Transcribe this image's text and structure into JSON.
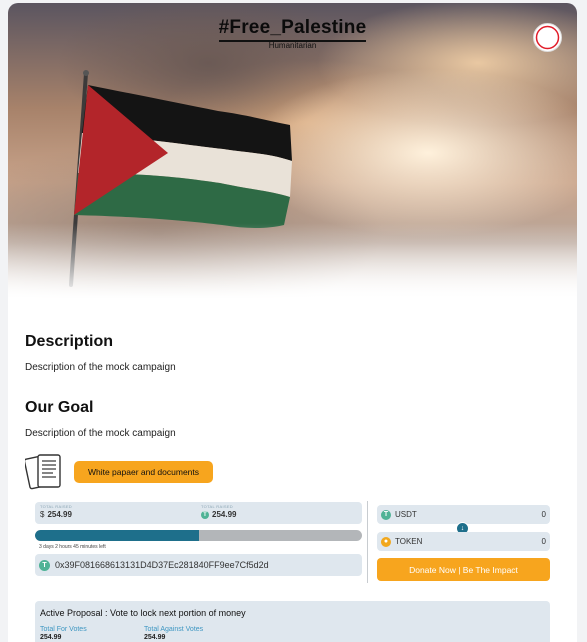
{
  "hero": {
    "title": "#Free_Palestine",
    "subtitle": "Humanitarian"
  },
  "description": {
    "heading": "Description",
    "text": "Description of the mock campaign"
  },
  "goal": {
    "heading": "Our Goal",
    "text": "Description of the mock campaign"
  },
  "documents": {
    "button_label": "White papaer and documents"
  },
  "stats": {
    "raised_label": "TOTAL RAISED",
    "raised_value": "254.99",
    "raised_currency": "$",
    "raised2_label": "TOTAL RAISED",
    "raised2_value": "254.99",
    "progress": 0.5,
    "time_left": "3 days 2 hours 45 minutes left",
    "address": "0x39F081668613131D4D37Ec281840FF9ee7Cf5d2d"
  },
  "swap": {
    "from_token": "USDT",
    "from_amount": "0",
    "to_token": "TOKEN",
    "to_amount": "0"
  },
  "donate": {
    "button_label": "Donate Now | Be The Impact"
  },
  "proposal": {
    "title": "Active Proposal : Vote to lock next portion of money",
    "for_label": "Total For Votes",
    "for_value": "254.99",
    "against_label": "Total Against Votes",
    "against_value": "254.99"
  },
  "colors": {
    "accent": "#f7a51e",
    "primary": "#1e6f8b",
    "tron": "#4fb396",
    "token": "#f2a81d"
  },
  "icons": {
    "logo": "red-crescent-icon",
    "documents": "documents-icon",
    "tron": "tron-icon",
    "swap": "arrow-down-icon"
  }
}
